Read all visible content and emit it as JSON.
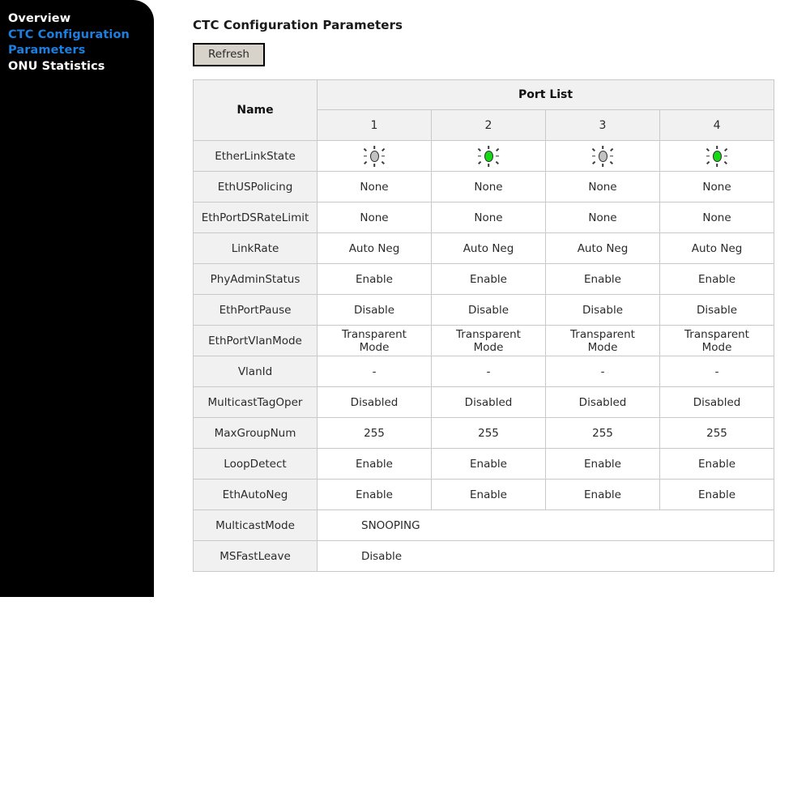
{
  "sidebar": {
    "items": [
      {
        "label": "Overview",
        "style": "white"
      },
      {
        "label": "CTC Configuration Parameters",
        "style": "blue"
      },
      {
        "label": "ONU Statistics",
        "style": "white"
      }
    ]
  },
  "content": {
    "page_title": "CTC Configuration Parameters",
    "refresh_label": "Refresh"
  },
  "table": {
    "name_header": "Name",
    "portlist_header": "Port List",
    "port_columns": [
      "1",
      "2",
      "3",
      "4"
    ],
    "rows": [
      {
        "name": "EtherLinkState",
        "kind": "led",
        "values": [
          "gray",
          "green",
          "gray",
          "green"
        ],
        "value_labels": [
          "Link Down",
          "Link Up",
          "Link Down",
          "Link Up"
        ]
      },
      {
        "name": "EthUSPolicing",
        "kind": "text",
        "values": [
          "None",
          "None",
          "None",
          "None"
        ]
      },
      {
        "name": "EthPortDSRateLimit",
        "kind": "text",
        "values": [
          "None",
          "None",
          "None",
          "None"
        ]
      },
      {
        "name": "LinkRate",
        "kind": "text",
        "values": [
          "Auto Neg",
          "Auto Neg",
          "Auto Neg",
          "Auto Neg"
        ]
      },
      {
        "name": "PhyAdminStatus",
        "kind": "text",
        "values": [
          "Enable",
          "Enable",
          "Enable",
          "Enable"
        ]
      },
      {
        "name": "EthPortPause",
        "kind": "text",
        "values": [
          "Disable",
          "Disable",
          "Disable",
          "Disable"
        ]
      },
      {
        "name": "EthPortVlanMode",
        "kind": "text2",
        "values": [
          "Transparent Mode",
          "Transparent Mode",
          "Transparent Mode",
          "Transparent Mode"
        ],
        "line1": "Transparent",
        "line2": "Mode"
      },
      {
        "name": "VlanId",
        "kind": "text",
        "values": [
          "-",
          "-",
          "-",
          "-"
        ]
      },
      {
        "name": "MulticastTagOper",
        "kind": "text",
        "values": [
          "Disabled",
          "Disabled",
          "Disabled",
          "Disabled"
        ]
      },
      {
        "name": "MaxGroupNum",
        "kind": "text",
        "values": [
          "255",
          "255",
          "255",
          "255"
        ]
      },
      {
        "name": "LoopDetect",
        "kind": "text",
        "values": [
          "Enable",
          "Enable",
          "Enable",
          "Enable"
        ]
      },
      {
        "name": "EthAutoNeg",
        "kind": "text",
        "values": [
          "Enable",
          "Enable",
          "Enable",
          "Enable"
        ]
      },
      {
        "name": "MulticastMode",
        "kind": "span",
        "value": "SNOOPING"
      },
      {
        "name": "MSFastLeave",
        "kind": "span",
        "value": "Disable"
      }
    ]
  },
  "colors": {
    "sidebar_bg": "#000000",
    "nav_active": "#1a7fe0",
    "nav_default": "#ffffff",
    "header_bg": "#f1f1f1",
    "led_up": "#16d916",
    "led_down": "#c2c2c2",
    "button_bg": "#d7d3ca"
  }
}
